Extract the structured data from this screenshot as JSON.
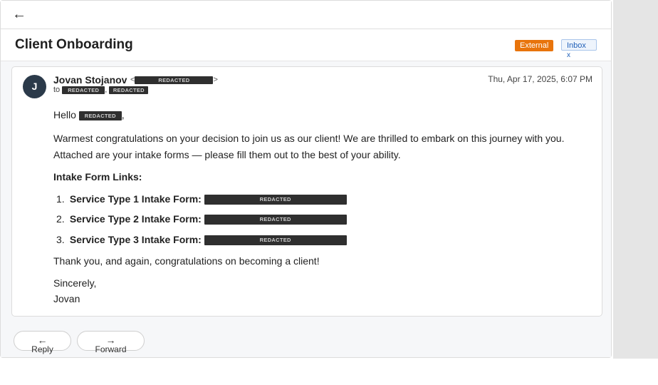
{
  "topbar": {
    "back_icon": "←"
  },
  "subject": {
    "title": "Client Onboarding",
    "tags": {
      "external": "External",
      "inbox": "Inbox",
      "inbox_remove": "x"
    }
  },
  "message": {
    "avatar_initial": "J",
    "sender_name": "Jovan Stojanov",
    "sender_email_redacted": "REDACTED",
    "to_label": "to",
    "recipients_redacted": [
      "REDACTED",
      "REDACTED"
    ],
    "date": "Thu, Apr 17, 2025, 6:07 PM",
    "body": {
      "greeting_prefix": "Hello",
      "greeting_name_redacted": "REDACTED",
      "greeting_suffix": ",",
      "paragraph": "Warmest congratulations on your decision to join us as our client! We are thrilled to embark on this journey with you. Attached are your intake forms — please fill them out to the best of your ability.",
      "links_heading": "Intake Form Links:",
      "links": [
        {
          "number": "1.",
          "label": "Service Type 1 Intake Form:",
          "url_redacted": "REDACTED"
        },
        {
          "number": "2.",
          "label": "Service Type 2 Intake Form:",
          "url_redacted": "REDACTED"
        },
        {
          "number": "3.",
          "label": "Service Type 3 Intake Form:",
          "url_redacted": "REDACTED"
        }
      ],
      "thanks": "Thank you, and again, congratulations on becoming a client!",
      "closing": "Sincerely,",
      "signature": "Jovan"
    }
  },
  "actions": {
    "reply": {
      "icon": "←",
      "label": "Reply"
    },
    "forward": {
      "icon": "→",
      "label": "Forward"
    }
  },
  "colors": {
    "external_badge": "#e8740c",
    "inbox_badge": "#1f5fb8",
    "avatar": "#2b3a4a"
  }
}
